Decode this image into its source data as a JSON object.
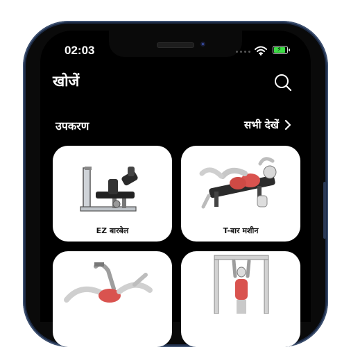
{
  "status_bar": {
    "time": "02:03"
  },
  "header": {
    "title": "खोजें",
    "search_icon": "search-icon"
  },
  "section": {
    "title": "उपकरण",
    "see_all_label": "सभी देखें",
    "see_all_icon": "chevron-right-icon"
  },
  "cards": [
    {
      "label": "EZ बारबेल",
      "icon": "leg-extension-machine-image"
    },
    {
      "label": "T-बार मशीन",
      "icon": "bench-crunch-exercise-image"
    },
    {
      "label": "",
      "icon": "lying-exercise-image"
    },
    {
      "label": "",
      "icon": "hanging-bar-exercise-image"
    }
  ],
  "colors": {
    "background": "#000000",
    "card": "#ffffff",
    "battery": "#3ddc45",
    "frame": "#1c2a44"
  }
}
